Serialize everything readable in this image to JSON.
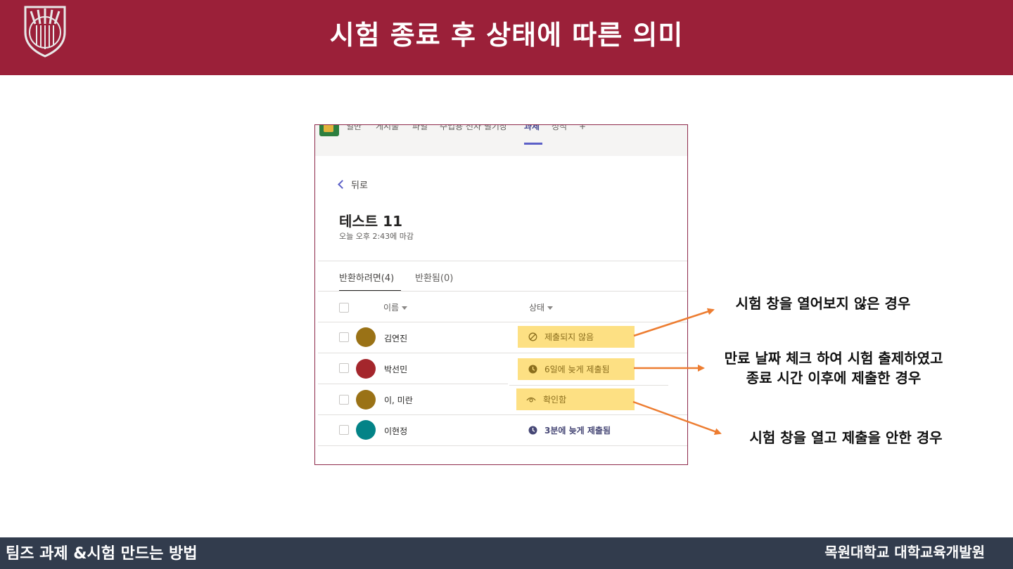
{
  "slide": {
    "title": "시험 종료 후 상태에 따른 의미",
    "footer_left": "팀즈 과제 &시험 만드는 방법",
    "footer_right": "목원대학교 대학교육개발원"
  },
  "teams": {
    "tabs": [
      "일반",
      "게시물",
      "파일",
      "수업용 전자 필기장",
      "과제",
      "성적",
      "+"
    ],
    "active_tab": "과제",
    "back_label": "뒤로",
    "assignment_title": "테스트 11",
    "due_text": "오늘 오후 2:43에 마감",
    "subtabs": {
      "to_return": "반환하려면(4)",
      "returned": "반환됨(0)"
    },
    "columns": {
      "name": "이름",
      "status": "상태"
    },
    "students": [
      {
        "name": "김연진",
        "status": "제출되지 않음",
        "avatar_color": "#9a7216",
        "status_icon": "not-submitted-icon"
      },
      {
        "name": "박선민",
        "status": "6일에 늦게 제출됨",
        "avatar_color": "#a4262c",
        "status_icon": "clock-icon"
      },
      {
        "name": "이, 미란",
        "status": "확인함",
        "avatar_color": "#9a7216",
        "status_icon": "eye-icon"
      },
      {
        "name": "이현정",
        "status": "3분에 늦게 제출됨",
        "avatar_color": "#038387",
        "status_icon": "clock-icon"
      }
    ]
  },
  "annotations": {
    "not_opened": "시험 창을 열어보지 않은 경우",
    "late_line1": "만료 날짜 체크 하여 시험 출제하였고",
    "late_line2": "종료 시간 이후에 제출한 경우",
    "opened_not_submitted": "시험 창을 열고 제출을 안한 경우"
  },
  "colors": {
    "header_bg": "#9b2039",
    "footer_bg": "#323c4d",
    "highlight": "#fde083",
    "arrow": "#ed7d31",
    "teams_accent": "#5b5fc7"
  }
}
